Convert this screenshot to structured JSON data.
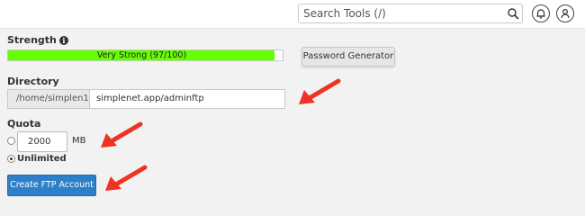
{
  "header": {
    "search_placeholder": "Search Tools (/)",
    "icons": [
      "search-icon",
      "bell-icon",
      "user-icon"
    ]
  },
  "strength": {
    "label": "Strength",
    "meter_text": "Very Strong (97/100)",
    "meter_value": 97,
    "meter_max": 100,
    "meter_color": "#66ff00",
    "generator_button": "Password Generator"
  },
  "directory": {
    "label": "Directory",
    "prefix": "/home/simplen1/",
    "value": "simplenet.app/adminftp"
  },
  "quota": {
    "label": "Quota",
    "value": "2000",
    "unit": "MB",
    "unlimited_label": "Unlimited",
    "selected": "unlimited"
  },
  "actions": {
    "create_button": "Create FTP Account",
    "create_button_color": "#2d7fc9"
  },
  "annotations": {
    "arrow_color": "#ee3322",
    "arrow_count": 4
  }
}
